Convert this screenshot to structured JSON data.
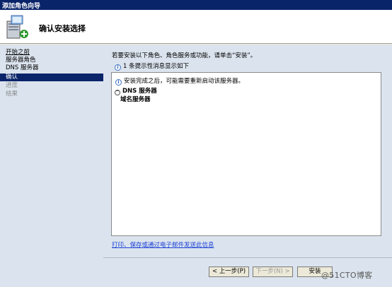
{
  "window": {
    "title": "添加角色向导"
  },
  "header": {
    "title": "确认安装选择",
    "icon": "server-roles-wizard-icon"
  },
  "nav": {
    "items": [
      {
        "label": "开始之前",
        "state": "link"
      },
      {
        "label": "服务器角色",
        "state": "normal"
      },
      {
        "label": "DNS 服务器",
        "state": "normal"
      },
      {
        "label": "确认",
        "state": "active"
      },
      {
        "label": "进度",
        "state": "disabled"
      },
      {
        "label": "结果",
        "state": "disabled"
      }
    ]
  },
  "content": {
    "intro": "若要安装以下角色、角色服务或功能，请单击“安装”。",
    "warning_count": "1 条提示性消息显示如下",
    "notice": "安装完成之后，可能需要重新启动该服务器。",
    "section_title": "DNS 服务器",
    "section_item": "域名服务器",
    "print_link": "打印、保存或通过电子邮件发送此信息"
  },
  "buttons": {
    "prev": "< 上一步(P)",
    "next": "下一步(N) >",
    "install": "安装"
  },
  "watermark": "@51CTO博客",
  "colors": {
    "selection": "#0a246a",
    "pane": "#dbe4ee",
    "link": "#1d41d6"
  }
}
